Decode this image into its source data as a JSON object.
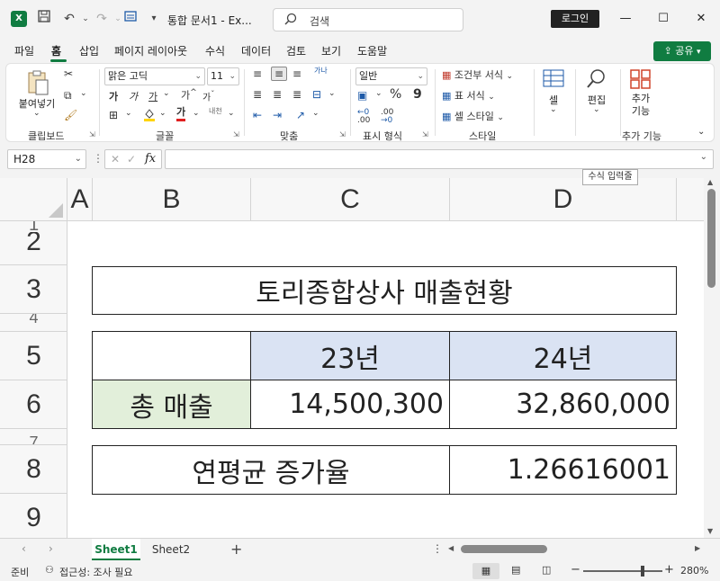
{
  "titlebar": {
    "app_icon": "X",
    "title": "통합 문서1 - Ex...",
    "search_placeholder": "검색",
    "login_label": "로그인",
    "icons": [
      "excel-icon",
      "save-icon",
      "undo-icon",
      "redo-icon",
      "customize-icon"
    ]
  },
  "ribbon_tabs": [
    "파일",
    "홈",
    "삽입",
    "페이지 레이아웃",
    "수식",
    "데이터",
    "검토",
    "보기",
    "도움말"
  ],
  "share_label": "공유",
  "ribbon": {
    "clipboard": {
      "paste_label": "붙여넣기",
      "group_label": "클립보드"
    },
    "font": {
      "font_name": "맑은 고딕",
      "font_size": "11",
      "bold": "가",
      "italic": "가",
      "underline": "가",
      "grow": "가",
      "shrink": "가",
      "color_glyph": "가",
      "phonetic": "내천",
      "group_label": "글꼴"
    },
    "alignment": {
      "wrap_glyph": "가나",
      "group_label": "맞춤"
    },
    "number": {
      "format": "일반",
      "percent": "%",
      "comma": "9",
      "inc_dec": ".00",
      "dec_dec": ".00",
      "group_label": "표시 형식"
    },
    "styles": {
      "conditional": "조건부 서식",
      "table": "표 서식",
      "cell_styles": "셀 스타일",
      "group_label": "스타일"
    },
    "cells": {
      "label": "셀"
    },
    "editing": {
      "label": "편집"
    },
    "addins": {
      "label_line1": "추가",
      "label_line2": "기능",
      "group_label": "추가 기능"
    }
  },
  "formula_bar": {
    "name_box": "H28",
    "cancel": "✕",
    "confirm": "✓",
    "fx": "fx",
    "value": "",
    "tooltip": "수식 입력줄"
  },
  "grid": {
    "columns": [
      "A",
      "B",
      "C",
      "D"
    ],
    "rows": [
      "2",
      "3",
      "5",
      "6",
      "8",
      "9"
    ],
    "title": "토리종합상사 매출현황",
    "header_23": "23년",
    "header_24": "24년",
    "total_label": "총 매출",
    "value_23": "14,500,300",
    "value_24": "32,860,000",
    "growth_label": "연평균 증가율",
    "growth_value": "1.26616001"
  },
  "sheets": [
    "Sheet1",
    "Sheet2"
  ],
  "statusbar": {
    "ready": "준비",
    "accessibility": "접근성: 조사 필요",
    "zoom": "280%"
  },
  "colors": {
    "accent": "#107c41",
    "header_fill": "#dae3f3",
    "total_fill": "#e2efda"
  }
}
